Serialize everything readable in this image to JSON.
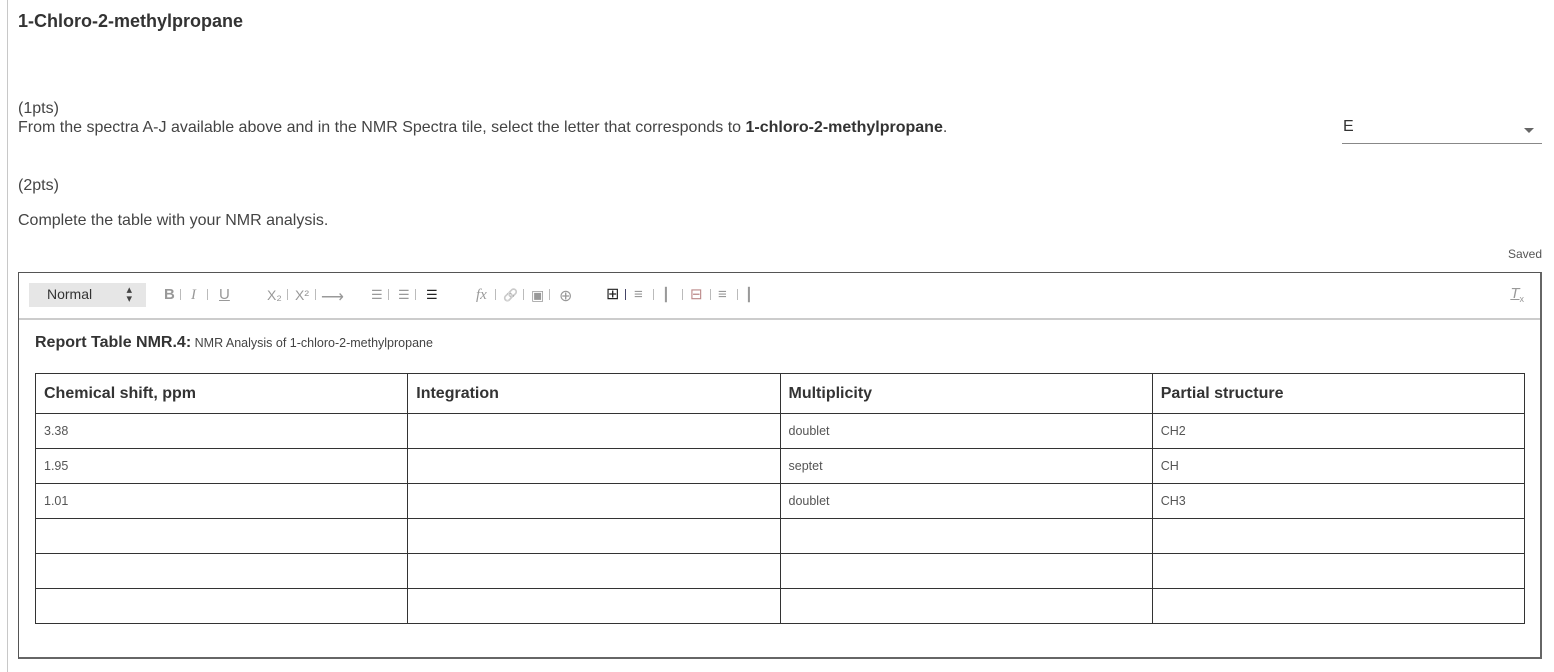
{
  "page": {
    "title": "1-Chloro-2-methylpropane"
  },
  "question1": {
    "points": "(1pts)",
    "text_before": "From the spectra A-J available above and in the NMR Spectra tile, select the letter that corresponds to ",
    "text_bold": "1-chloro-2-methylpropane",
    "text_after": ".",
    "selected_value": "E"
  },
  "question2": {
    "points": "(2pts)",
    "text": "Complete the table with your NMR analysis.",
    "status": "Saved"
  },
  "editor": {
    "toolbar": {
      "format_select": "Normal",
      "format_arrows": "▴▾",
      "bold": "B",
      "italic": "I",
      "underline": "U",
      "subscript": "X₂",
      "superscript": "X²",
      "arrow": "⟶",
      "ordered_list": "☰",
      "unordered_list": "☰",
      "align": "☰",
      "formula": "fx",
      "link": "🔗",
      "image": "▣",
      "attachment": "⊕",
      "table": "⊞",
      "insert_row": "≡",
      "insert_col": "┃",
      "delete_table": "⊟",
      "delete_row": "≡",
      "delete_col": "┃",
      "clear_format": "T",
      "clear_format_sub": "x"
    },
    "caption_bold": "Report Table NMR.4:",
    "caption_text": " NMR Analysis of 1-chloro-2-methylpropane",
    "table": {
      "headers": [
        "Chemical shift, ppm",
        "Integration",
        "Multiplicity",
        "Partial structure"
      ],
      "rows": [
        [
          "3.38",
          "",
          "doublet",
          "CH2"
        ],
        [
          "1.95",
          "",
          "septet",
          "CH"
        ],
        [
          "1.01",
          "",
          "doublet",
          "CH3"
        ],
        [
          "",
          "",
          "",
          ""
        ],
        [
          "",
          "",
          "",
          ""
        ],
        [
          "",
          "",
          "",
          ""
        ]
      ]
    }
  }
}
